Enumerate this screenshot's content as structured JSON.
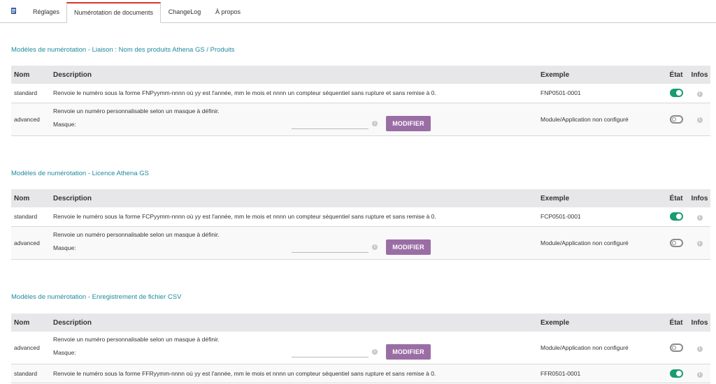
{
  "tabs": [
    {
      "label": ""
    },
    {
      "label": "Réglages"
    },
    {
      "label": "Numérotation de documents"
    },
    {
      "label": "ChangeLog"
    },
    {
      "label": "À propos"
    }
  ],
  "headers": {
    "nom": "Nom",
    "description": "Description",
    "exemple": "Exemple",
    "etat": "État",
    "infos": "Infos"
  },
  "info_glyph": "i",
  "sections": [
    {
      "title": "Modèles de numérotation - Liaison : Nom des produits Athena GS / Produits",
      "rows": [
        {
          "type": "standard",
          "nom": "standard",
          "description": "Renvoie le numéro sous la forme FNPyymm-nnnn où yy est l'année, mm le mois et nnnn un compteur séquentiel sans rupture et sans remise à 0.",
          "exemple": "FNP0501-0001",
          "etat": "on"
        },
        {
          "type": "advanced",
          "nom": "advanced",
          "description": "Renvoie un numéro personnalisable selon un masque à définir.",
          "masque_label": "Masque:",
          "masque_value": "",
          "button": "MODIFIER",
          "exemple": "Module/Application non configuré",
          "etat": "off"
        }
      ]
    },
    {
      "title": "Modèles de numérotation - Licence Athena GS",
      "rows": [
        {
          "type": "standard",
          "nom": "standard",
          "description": "Renvoie le numéro sous la forme FCPyymm-nnnn où yy est l'année, mm le mois et nnnn un compteur séquentiel sans rupture et sans remise à 0.",
          "exemple": "FCP0501-0001",
          "etat": "on"
        },
        {
          "type": "advanced",
          "nom": "advanced",
          "description": "Renvoie un numéro personnalisable selon un masque à définir.",
          "masque_label": "Masque:",
          "masque_value": "",
          "button": "MODIFIER",
          "exemple": "Module/Application non configuré",
          "etat": "off"
        }
      ]
    },
    {
      "title": "Modèles de numérotation - Enregistrement de fichier CSV",
      "rows": [
        {
          "type": "advanced",
          "nom": "advanced",
          "description": "Renvoie un numéro personnalisable selon un masque à définir.",
          "masque_label": "Masque:",
          "masque_value": "",
          "button": "MODIFIER",
          "exemple": "Module/Application non configuré",
          "etat": "off"
        },
        {
          "type": "standard",
          "nom": "standard",
          "description": "Renvoie le numéro sous la forme FFRyymm-nnnn où yy est l'année, mm le mois et nnnn un compteur séquentiel sans rupture et sans remise à 0.",
          "exemple": "FFR0501-0001",
          "etat": "on"
        }
      ]
    }
  ],
  "colors": {
    "accent_tab": "#d9342b",
    "section_title": "#1f8a9c",
    "toggle_on": "#199c6f",
    "button": "#9a6ea5"
  }
}
